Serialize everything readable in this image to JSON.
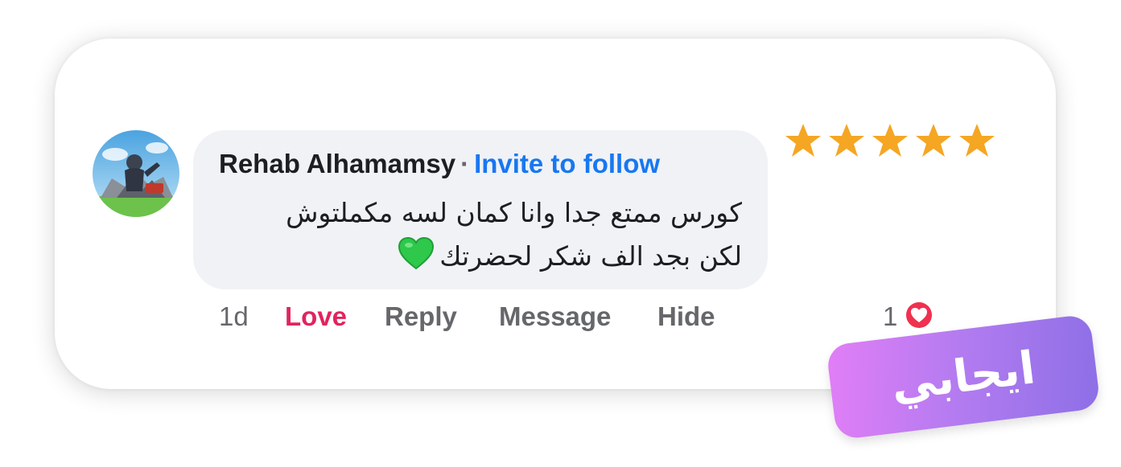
{
  "comment": {
    "author": "Rehab Alhamamsy",
    "separator": "·",
    "invite_label": "Invite to follow",
    "text_line_1": "كورس ممتع جدا وانا كمان لسه مكملتوش",
    "text_line_2": "لكن بجد الف شكر لحضرتك",
    "emoji": "green-heart-icon"
  },
  "actions": {
    "time": "1d",
    "love": "Love",
    "reply": "Reply",
    "message": "Message",
    "hide": "Hide"
  },
  "reactions": {
    "count": "1",
    "icon": "love-reaction-icon"
  },
  "rating": {
    "value": 5,
    "max": 5,
    "color": "#f5a623"
  },
  "badge": {
    "label": "ايجابي"
  },
  "colors": {
    "link_blue": "#1877f2",
    "love_red": "#e0245e",
    "bubble_bg": "#f0f2f5",
    "badge_gradient_start": "#e27ef6",
    "badge_gradient_end": "#8d6fe6"
  }
}
